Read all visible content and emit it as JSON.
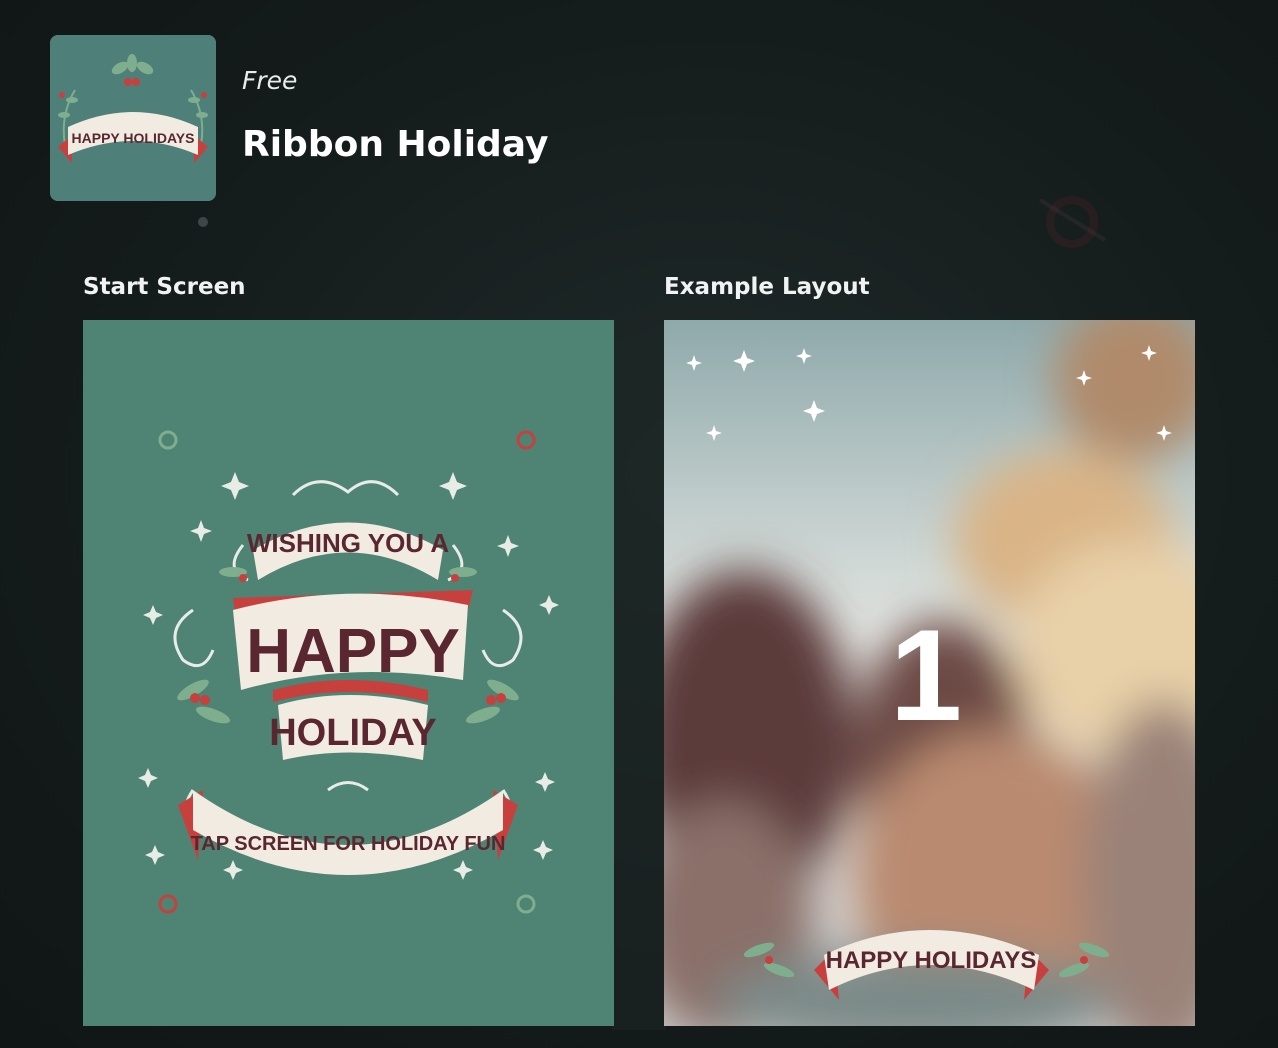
{
  "header": {
    "price_label": "Free",
    "title": "Ribbon Holiday",
    "thumbnail_text": "HAPPY HOLIDAYS"
  },
  "sections": {
    "start_screen_label": "Start Screen",
    "example_layout_label": "Example Layout"
  },
  "start_screen": {
    "ribbon_top": "WISHING YOU A",
    "main_line1": "HAPPY",
    "main_line2": "HOLIDAY",
    "ribbon_bottom": "TAP SCREEN FOR HOLIDAY FUN"
  },
  "example_layout": {
    "countdown": "1",
    "banner": "HAPPY HOLIDAYS"
  },
  "colors": {
    "card_green": "#4f8373",
    "ribbon_cream": "#f1ebe2",
    "ribbon_red": "#c8403e",
    "text_maroon": "#5a2630"
  }
}
